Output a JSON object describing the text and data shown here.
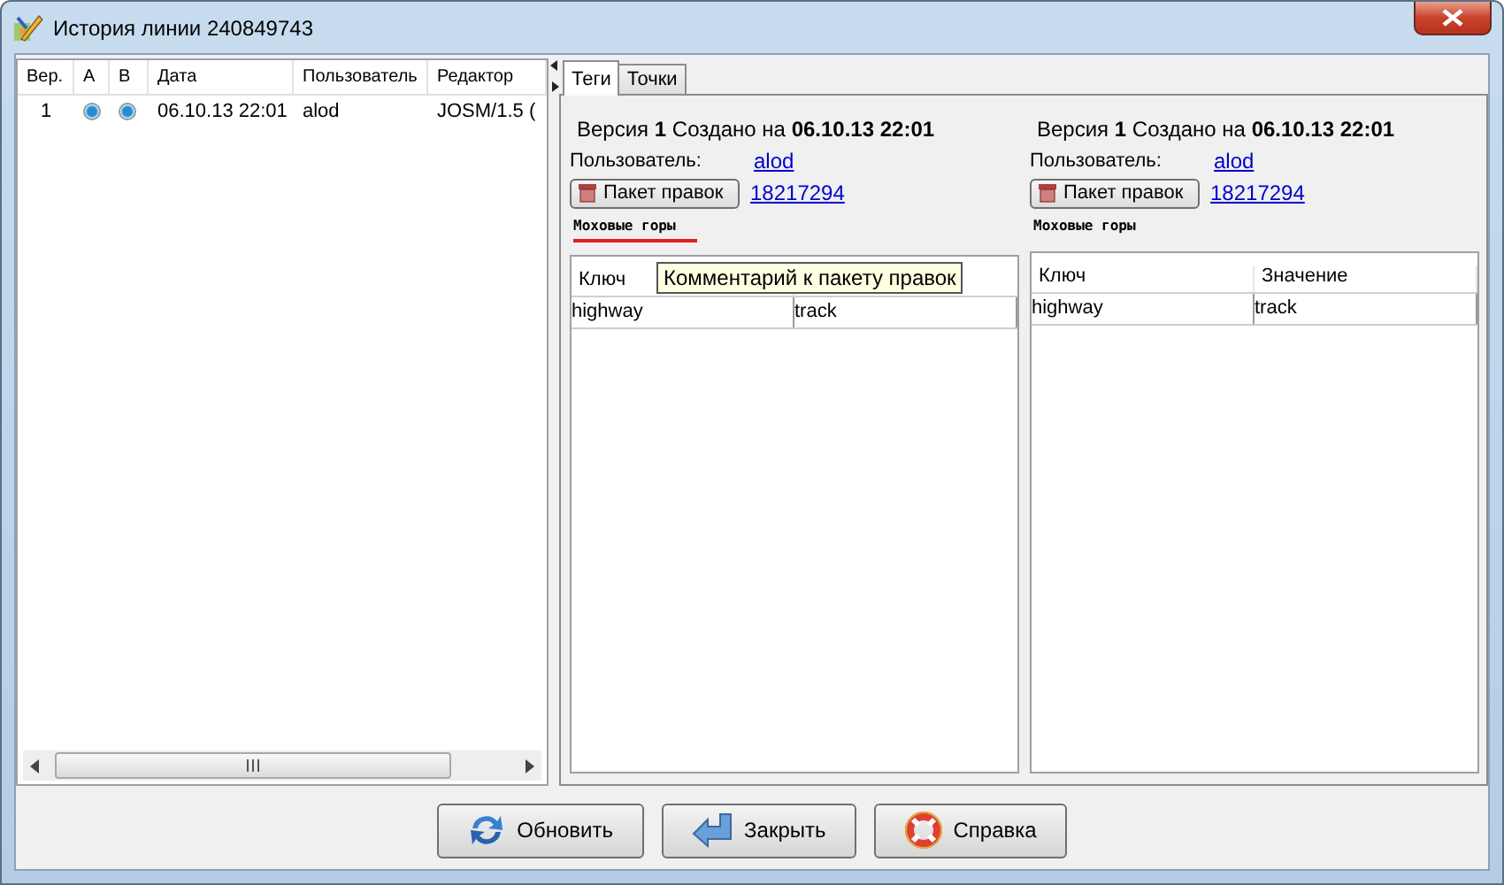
{
  "window": {
    "title": "История линии 240849743"
  },
  "history_table": {
    "columns": [
      "Вер.",
      "А",
      "В",
      "Дата",
      "Пользователь",
      "Редактор"
    ],
    "rows": [
      {
        "version": "1",
        "a_selected": true,
        "b_selected": true,
        "date": "06.10.13 22:01",
        "user": "alod",
        "editor": "JOSM/1.5 ("
      }
    ]
  },
  "tabs": [
    {
      "label": "Теги",
      "selected": true
    },
    {
      "label": "Точки",
      "selected": false
    }
  ],
  "versions": [
    {
      "heading": "Версия **1** Создано на **06.10.13 22:01**",
      "user_label": "Пользователь:",
      "user": "alod",
      "changeset_button": "Пакет правок",
      "changeset": "18217294",
      "comment": "Моховые горы",
      "comment_underlined": true,
      "tag_columns": [
        "Ключ"
      ],
      "tags": [
        {
          "key": "highway",
          "value": "track"
        }
      ]
    },
    {
      "heading": "Версия **1** Создано на **06.10.13 22:01**",
      "user_label": "Пользователь:",
      "user": "alod",
      "changeset_button": "Пакет правок",
      "changeset": "18217294",
      "comment": "Моховые горы",
      "comment_underlined": false,
      "tag_columns": [
        "Ключ",
        "Значение"
      ],
      "tags": [
        {
          "key": "highway",
          "value": "track"
        }
      ]
    }
  ],
  "tooltip": "Комментарий к пакету правок",
  "buttons": [
    {
      "label": "Обновить",
      "kind": "refresh"
    },
    {
      "label": "Закрыть",
      "kind": "close"
    },
    {
      "label": "Справка",
      "kind": "help"
    }
  ]
}
